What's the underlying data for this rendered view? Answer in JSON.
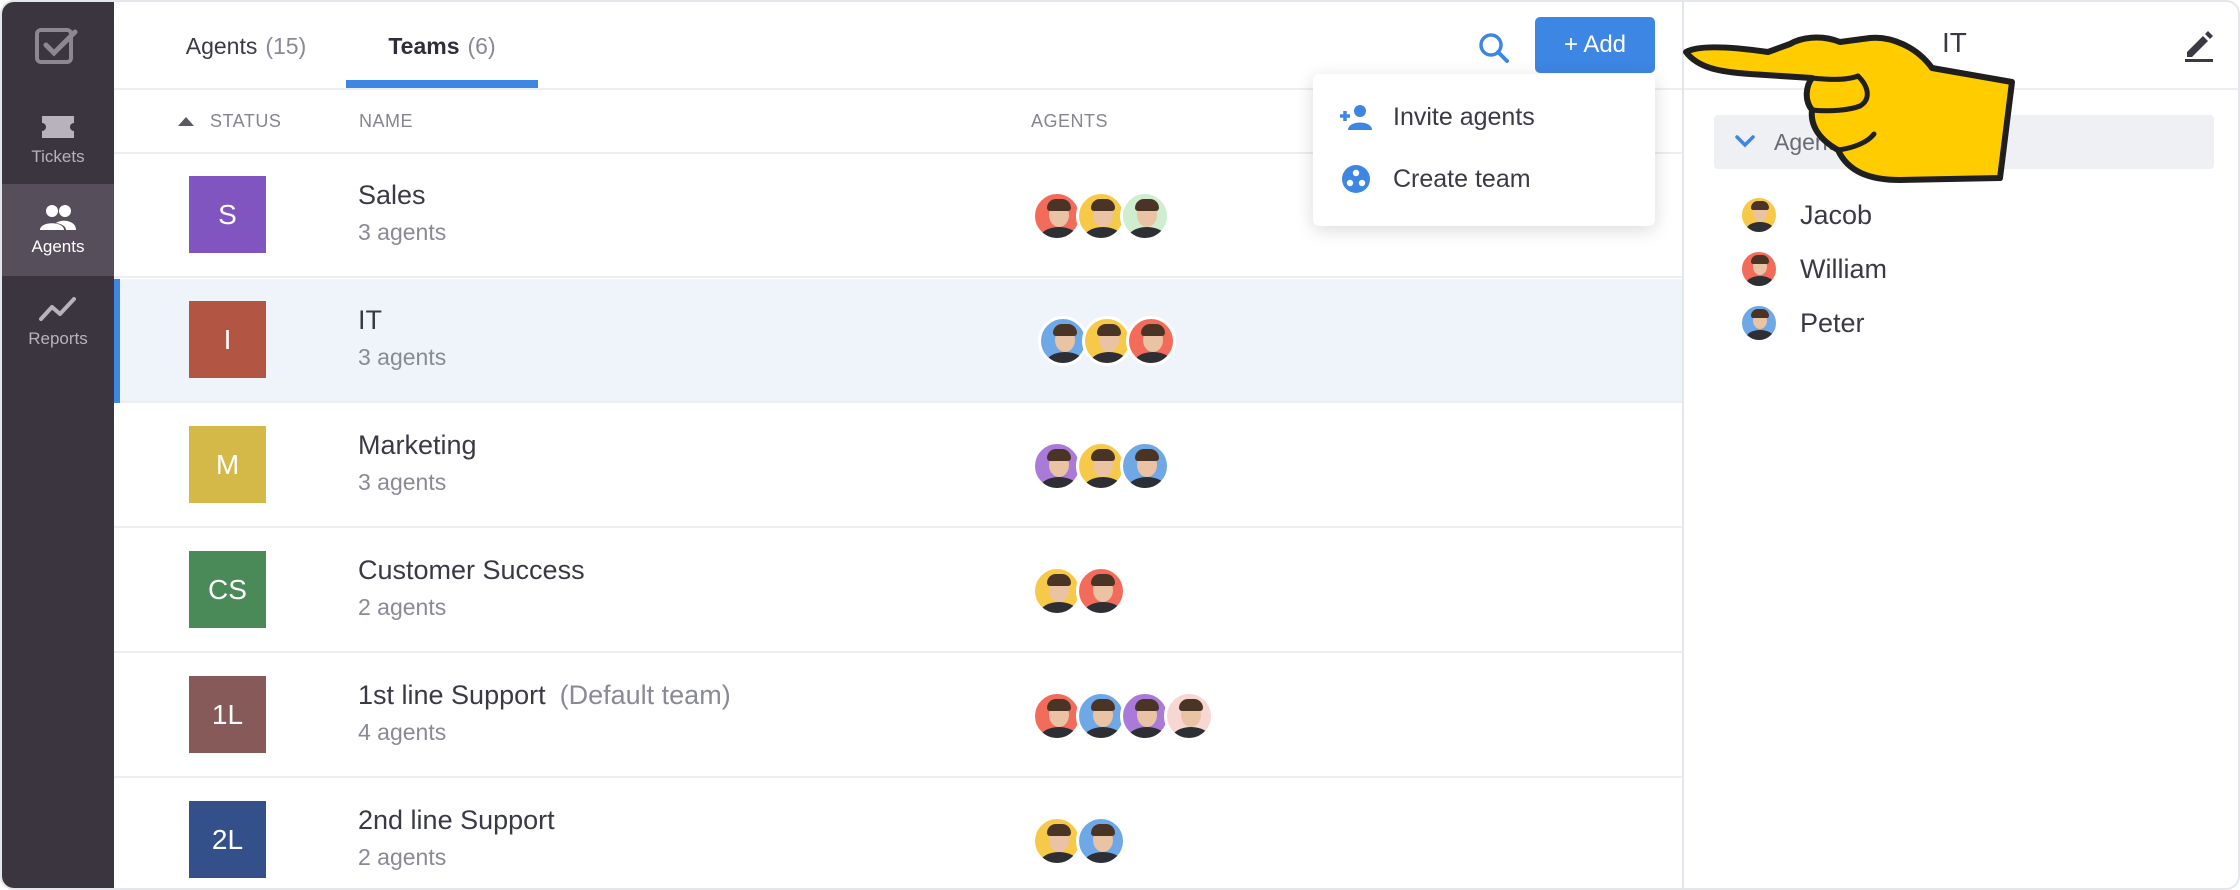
{
  "sidebar": {
    "logo": "app-logo-icon",
    "items": [
      {
        "label": "Tickets",
        "icon": "ticket-icon",
        "active": false
      },
      {
        "label": "Agents",
        "icon": "people-icon",
        "active": true
      },
      {
        "label": "Reports",
        "icon": "chart-line-icon",
        "active": false
      }
    ]
  },
  "tabs": [
    {
      "label": "Agents",
      "count": "(15)",
      "active": false
    },
    {
      "label": "Teams",
      "count": "(6)",
      "active": true
    }
  ],
  "toolbar": {
    "search_icon": "search-icon",
    "add_label": "+ Add"
  },
  "columns": {
    "status": "STATUS",
    "name": "NAME",
    "agents": "AGENTS"
  },
  "teams": [
    {
      "badge": "S",
      "color": "#8155bf",
      "name": "Sales",
      "count": "3 agents",
      "default": "",
      "avatars": [
        "#f26b5b",
        "#f7c948",
        "#cfeecf"
      ],
      "selected": false
    },
    {
      "badge": "I",
      "color": "#b35543",
      "name": "IT",
      "count": "3 agents",
      "default": "",
      "avatars": [
        "#6ea8e6",
        "#f7c948",
        "#f26b5b"
      ],
      "selected": true
    },
    {
      "badge": "M",
      "color": "#d4b948",
      "name": "Marketing",
      "count": "3 agents",
      "default": "",
      "avatars": [
        "#a97ad8",
        "#f7c948",
        "#6ea8e6"
      ],
      "selected": false
    },
    {
      "badge": "CS",
      "color": "#4a8a58",
      "name": "Customer Success",
      "count": "2 agents",
      "default": "",
      "avatars": [
        "#f7c948",
        "#f26b5b"
      ],
      "selected": false
    },
    {
      "badge": "1L",
      "color": "#875a5a",
      "name": "1st line Support",
      "count": "4 agents",
      "default": "(Default team)",
      "avatars": [
        "#f26b5b",
        "#6ea8e6",
        "#a97ad8",
        "#f8d7d2"
      ],
      "selected": false
    },
    {
      "badge": "2L",
      "color": "#33508a",
      "name": "2nd line Support",
      "count": "2 agents",
      "default": "",
      "avatars": [
        "#f7c948",
        "#6ea8e6"
      ],
      "selected": false
    }
  ],
  "dropdown": {
    "items": [
      {
        "label": "Invite agents",
        "icon": "add-person-icon"
      },
      {
        "label": "Create team",
        "icon": "team-circle-icon"
      }
    ]
  },
  "panel": {
    "title": "IT",
    "edit_icon": "pencil-icon",
    "section_label": "Agents",
    "members": [
      {
        "name": "Jacob",
        "color": "#f7c948"
      },
      {
        "name": "William",
        "color": "#f26b5b"
      },
      {
        "name": "Peter",
        "color": "#6ea8e6"
      }
    ]
  },
  "colors": {
    "accent": "#3e86e3",
    "sidebar": "#3b3540",
    "pointer_hand": "#ffcc00"
  }
}
